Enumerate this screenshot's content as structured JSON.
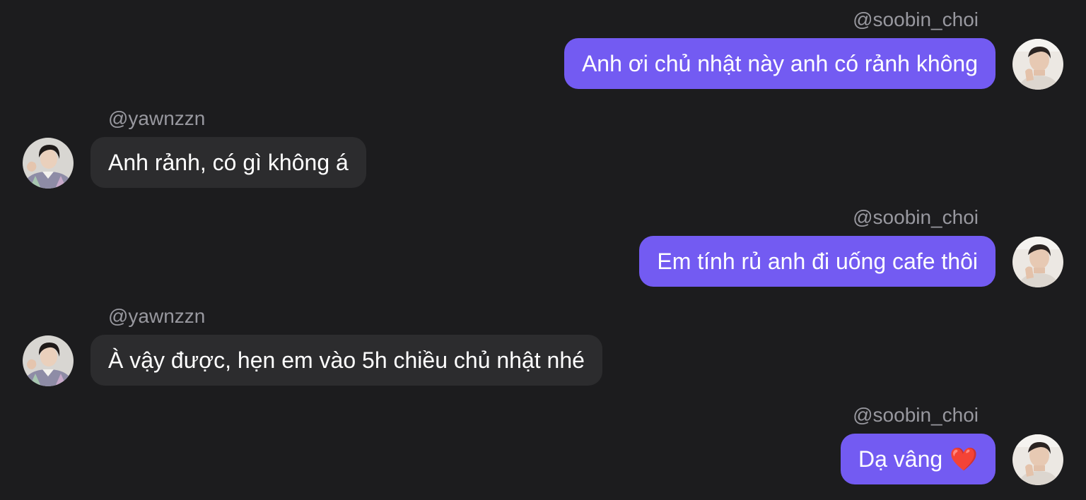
{
  "messages": [
    {
      "direction": "out",
      "username": "@soobin_choi",
      "text": "Anh ơi chủ nhật này anh có rảnh không",
      "avatar_icon": "soobin-avatar"
    },
    {
      "direction": "in",
      "username": "@yawnzzn",
      "text": "Anh rảnh, có gì không á",
      "avatar_icon": "yawnzzn-avatar"
    },
    {
      "direction": "out",
      "username": "@soobin_choi",
      "text": "Em tính rủ anh đi uống cafe thôi",
      "avatar_icon": "soobin-avatar"
    },
    {
      "direction": "in",
      "username": "@yawnzzn",
      "text": "À vậy được, hẹn em vào 5h chiều chủ nhật nhé",
      "avatar_icon": "yawnzzn-avatar"
    },
    {
      "direction": "out",
      "username": "@soobin_choi",
      "text": "Dạ vâng",
      "emoji": "❤️",
      "avatar_icon": "soobin-avatar"
    }
  ],
  "colors": {
    "background": "#1c1c1e",
    "outgoing_bubble": "#735bf2",
    "incoming_bubble": "#2c2c2e",
    "username": "#98989f",
    "text": "#ffffff"
  }
}
